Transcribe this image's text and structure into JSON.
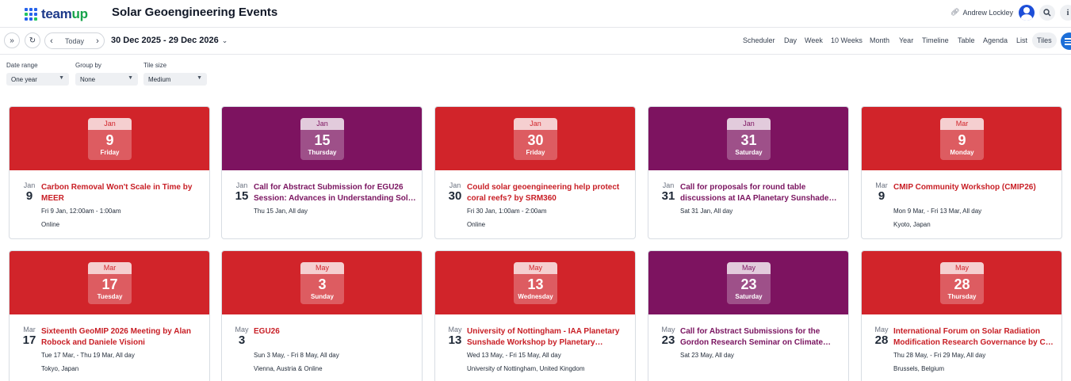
{
  "app": {
    "logo_text_team": "team",
    "logo_text_up": "up",
    "calendar_title": "Solar Geoengineering Events",
    "user_name": "Andrew Lockley"
  },
  "icons": {
    "link": "link-icon",
    "search": "search-icon",
    "info": "info-icon",
    "avatar": "user-avatar-icon"
  },
  "toolbar": {
    "today_label": "Today",
    "date_range": "30 Dec 2025 - 29 Dec 2026",
    "views": [
      "Scheduler",
      "Day",
      "Week",
      "10 Weeks",
      "Month",
      "Year",
      "Timeline",
      "Table",
      "Agenda",
      "List",
      "Tiles"
    ],
    "active_view": "Tiles"
  },
  "filters": {
    "date_range_label": "Date range",
    "date_range_value": "One year",
    "group_by_label": "Group by",
    "group_by_value": "None",
    "tile_size_label": "Tile size",
    "tile_size_value": "Medium"
  },
  "colors": {
    "red": "#d1242a",
    "purple": "#7d1360",
    "red_title": "#c81e25",
    "purple_title": "#7a1460"
  },
  "events": [
    {
      "month": "Jan",
      "day": "9",
      "weekday": "Friday",
      "color": "red",
      "title": "Carbon Removal Won't Scale in Time by MEER",
      "time": "Fri 9 Jan, 12:00am - 1:00am",
      "location": "Online"
    },
    {
      "month": "Jan",
      "day": "15",
      "weekday": "Thursday",
      "color": "purple",
      "title": "Call for Abstract Submission for EGU26 Session: Advances in Understanding Sol…",
      "time": "Thu 15 Jan, All day",
      "location": ""
    },
    {
      "month": "Jan",
      "day": "30",
      "weekday": "Friday",
      "color": "red",
      "title": "Could solar geoengineering help protect coral reefs? by SRM360",
      "time": "Fri 30 Jan, 1:00am - 2:00am",
      "location": "Online"
    },
    {
      "month": "Jan",
      "day": "31",
      "weekday": "Saturday",
      "color": "purple",
      "title": "Call for proposals for round table discussions at IAA Planetary Sunshade…",
      "time": "Sat 31 Jan, All day",
      "location": ""
    },
    {
      "month": "Mar",
      "day": "9",
      "weekday": "Monday",
      "color": "red",
      "title": "CMIP Community Workshop (CMIP26)",
      "time": "Mon 9 Mar, - Fri 13 Mar, All day",
      "location": "Kyoto, Japan"
    },
    {
      "month": "Mar",
      "day": "17",
      "weekday": "Tuesday",
      "color": "red",
      "title": "Sixteenth GeoMIP 2026 Meeting by Alan Robock and Daniele Visioni",
      "time": "Tue 17 Mar, - Thu 19 Mar, All day",
      "location": "Tokyo, Japan"
    },
    {
      "month": "May",
      "day": "3",
      "weekday": "Sunday",
      "color": "red",
      "title": "EGU26",
      "time": "Sun 3 May, - Fri 8 May, All day",
      "location": "Vienna, Austria & Online"
    },
    {
      "month": "May",
      "day": "13",
      "weekday": "Wednesday",
      "color": "red",
      "title": "University of Nottingham - IAA Planetary Sunshade Workshop by Planetary…",
      "time": "Wed 13 May, - Fri 15 May, All day",
      "location": "University of Nottingham, United Kingdom"
    },
    {
      "month": "May",
      "day": "23",
      "weekday": "Saturday",
      "color": "purple",
      "title": "Call for Abstract Submissions for the Gordon Research Seminar on Climate…",
      "time": "Sat 23 May, All day",
      "location": ""
    },
    {
      "month": "May",
      "day": "28",
      "weekday": "Thursday",
      "color": "red",
      "title": "International Forum on Solar Radiation Modification Research Governance by C…",
      "time": "Thu 28 May, - Fri 29 May, All day",
      "location": "Brussels, Belgium"
    }
  ]
}
